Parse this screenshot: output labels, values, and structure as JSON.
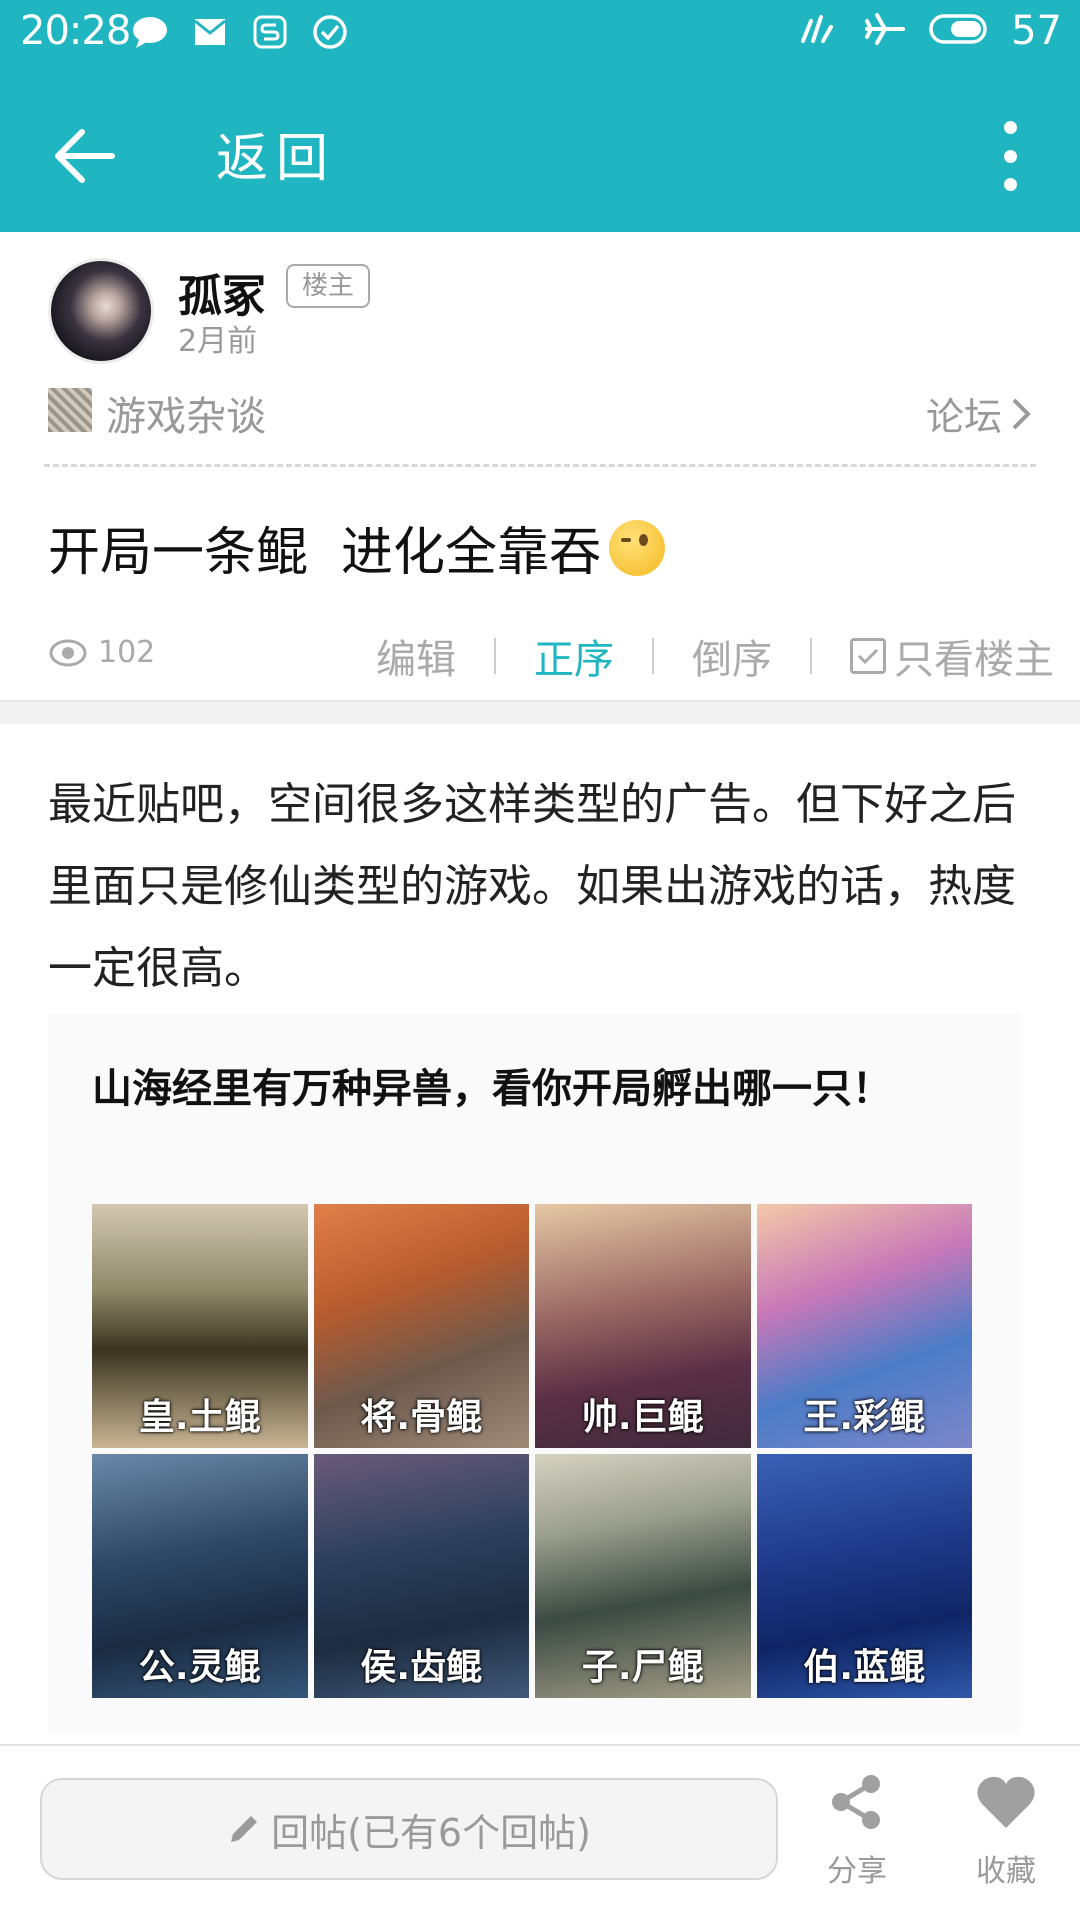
{
  "status_bar": {
    "time": "20:28",
    "battery": "57",
    "icons": [
      "chat-bubble-icon",
      "mail-icon",
      "s-app-icon",
      "check-circle-icon",
      "signal-icon",
      "airplane-icon",
      "battery-icon"
    ]
  },
  "app_bar": {
    "back_label": "返回",
    "accent_color": "#1fb6c1"
  },
  "post": {
    "author_name": "孤冢",
    "owner_badge": "楼主",
    "post_time": "2月前",
    "forum_name": "游戏杂谈",
    "forum_link": "论坛",
    "title": "开局一条鲲  进化全靠吞",
    "views": "102",
    "actions": {
      "edit": "编辑",
      "asc": "正序",
      "desc": "倒序",
      "only_owner": "只看楼主"
    },
    "body": "最近贴吧，空间很多这样类型的广告。但下好之后里面只是修仙类型的游戏。如果出游戏的话，热度一定很高。"
  },
  "image": {
    "caption": "山海经里有万种异兽，看你开局孵出哪一只！",
    "tiles": [
      "皇.土鲲",
      "将.骨鲲",
      "帅.巨鲲",
      "王.彩鲲",
      "公.灵鲲",
      "侯.齿鲲",
      "子.尸鲲",
      "伯.蓝鲲"
    ]
  },
  "bottom_bar": {
    "reply_placeholder": "回帖(已有6个回帖)",
    "share_label": "分享",
    "favorite_label": "收藏"
  }
}
